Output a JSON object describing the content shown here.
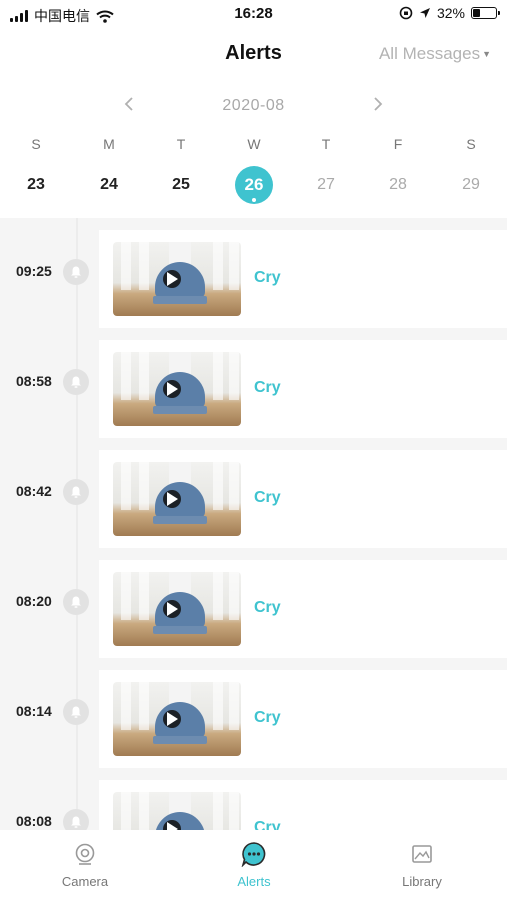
{
  "status_bar": {
    "carrier": "中国电信",
    "time": "16:28",
    "battery": "32%",
    "battery_level": 0.32
  },
  "header": {
    "title": "Alerts",
    "filter_label": "All Messages"
  },
  "calendar": {
    "month": "2020-08",
    "days": [
      {
        "dow": "S",
        "date": "23",
        "state": "past"
      },
      {
        "dow": "M",
        "date": "24",
        "state": "past"
      },
      {
        "dow": "T",
        "date": "25",
        "state": "past"
      },
      {
        "dow": "W",
        "date": "26",
        "state": "selected"
      },
      {
        "dow": "T",
        "date": "27",
        "state": "future"
      },
      {
        "dow": "F",
        "date": "28",
        "state": "future"
      },
      {
        "dow": "S",
        "date": "29",
        "state": "future"
      }
    ]
  },
  "alerts": [
    {
      "time": "09:25",
      "label": "Cry"
    },
    {
      "time": "08:58",
      "label": "Cry"
    },
    {
      "time": "08:42",
      "label": "Cry"
    },
    {
      "time": "08:20",
      "label": "Cry"
    },
    {
      "time": "08:14",
      "label": "Cry"
    },
    {
      "time": "08:08",
      "label": "Cry"
    }
  ],
  "tabs": [
    {
      "label": "Camera",
      "icon": "camera-icon",
      "active": false
    },
    {
      "label": "Alerts",
      "icon": "chat-bubble-icon",
      "active": true
    },
    {
      "label": "Library",
      "icon": "image-icon",
      "active": false
    }
  ],
  "colors": {
    "accent": "#3fc3cf"
  }
}
